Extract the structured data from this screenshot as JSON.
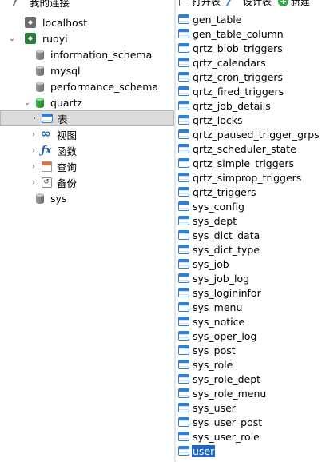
{
  "navigator": {
    "header_label": "我的连接",
    "connections": [
      {
        "name": "localhost",
        "expanded": false
      },
      {
        "name": "ruoyi",
        "expanded": true
      }
    ],
    "databases": [
      {
        "name": "information_schema"
      },
      {
        "name": "mysql"
      },
      {
        "name": "performance_schema"
      },
      {
        "name": "quartz",
        "expanded": true,
        "active": true
      },
      {
        "name": "sys"
      }
    ],
    "object_types": [
      {
        "label": "表",
        "icon": "table-icon",
        "selected": true
      },
      {
        "label": "视图",
        "icon": "view-icon"
      },
      {
        "label": "函数",
        "icon": "function-icon"
      },
      {
        "label": "查询",
        "icon": "query-icon"
      },
      {
        "label": "备份",
        "icon": "backup-icon"
      }
    ]
  },
  "toolbar": {
    "open_table_label": "打开表",
    "design_table_label": "设计表",
    "new_table_label": "新建"
  },
  "tables": [
    "gen_table",
    "gen_table_column",
    "qrtz_blob_triggers",
    "qrtz_calendars",
    "qrtz_cron_triggers",
    "qrtz_fired_triggers",
    "qrtz_job_details",
    "qrtz_locks",
    "qrtz_paused_trigger_grps",
    "qrtz_scheduler_state",
    "qrtz_simple_triggers",
    "qrtz_simprop_triggers",
    "qrtz_triggers",
    "sys_config",
    "sys_dept",
    "sys_dict_data",
    "sys_dict_type",
    "sys_job",
    "sys_job_log",
    "sys_logininfor",
    "sys_menu",
    "sys_notice",
    "sys_oper_log",
    "sys_post",
    "sys_role",
    "sys_role_dept",
    "sys_role_menu",
    "sys_user",
    "sys_user_post",
    "sys_user_role",
    "user"
  ],
  "selected_table": "user",
  "colors": {
    "selection_blue": "#1f66c9",
    "tree_selection_gray": "#dcdcdc",
    "table_icon_blue": "#2f80d1",
    "active_db_green": "#2d9a3a"
  }
}
